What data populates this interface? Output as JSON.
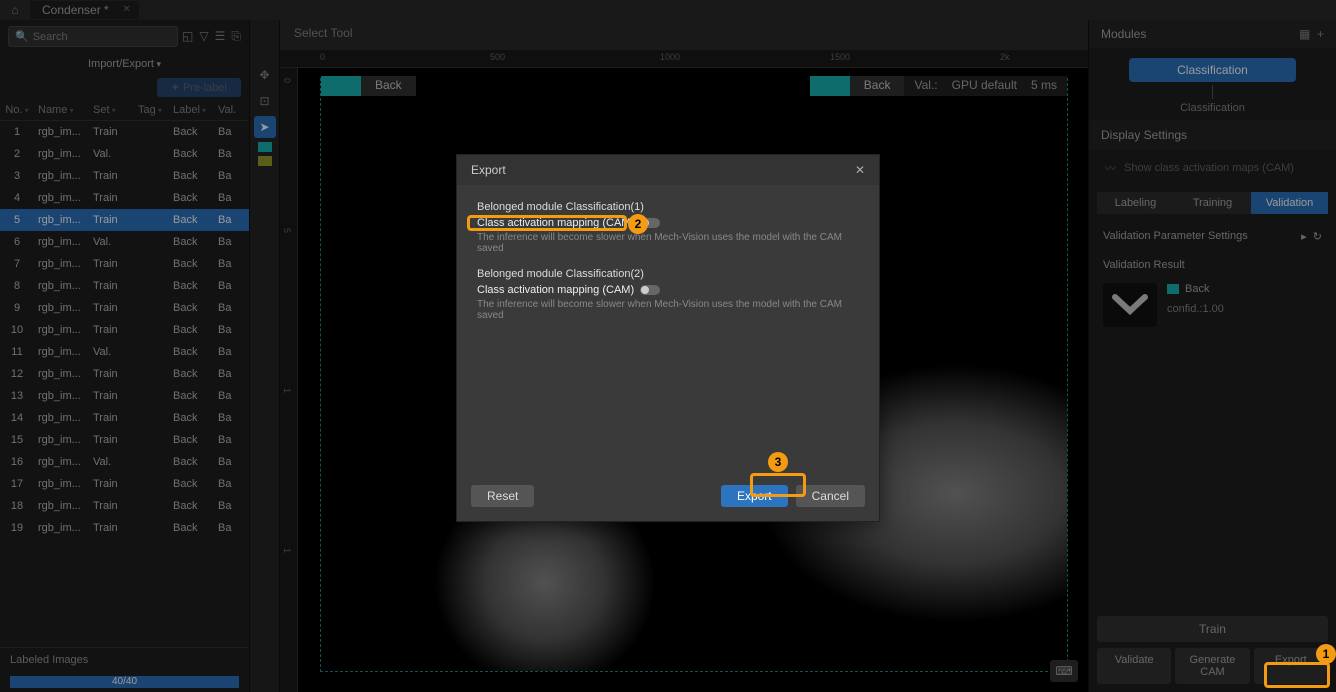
{
  "tab": {
    "title": "Condenser *"
  },
  "search": {
    "placeholder": "Search"
  },
  "left": {
    "import_export": "Import/Export",
    "prelabel": "Pre-label",
    "columns": {
      "no": "No.",
      "name": "Name",
      "set": "Set",
      "tag": "Tag",
      "label": "Label",
      "val": "Val."
    },
    "rows": [
      {
        "no": "1",
        "name": "rgb_im...",
        "set": "Train",
        "label": "Back",
        "val": "Ba"
      },
      {
        "no": "2",
        "name": "rgb_im...",
        "set": "Val.",
        "label": "Back",
        "val": "Ba"
      },
      {
        "no": "3",
        "name": "rgb_im...",
        "set": "Train",
        "label": "Back",
        "val": "Ba"
      },
      {
        "no": "4",
        "name": "rgb_im...",
        "set": "Train",
        "label": "Back",
        "val": "Ba"
      },
      {
        "no": "5",
        "name": "rgb_im...",
        "set": "Train",
        "label": "Back",
        "val": "Ba"
      },
      {
        "no": "6",
        "name": "rgb_im...",
        "set": "Val.",
        "label": "Back",
        "val": "Ba"
      },
      {
        "no": "7",
        "name": "rgb_im...",
        "set": "Train",
        "label": "Back",
        "val": "Ba"
      },
      {
        "no": "8",
        "name": "rgb_im...",
        "set": "Train",
        "label": "Back",
        "val": "Ba"
      },
      {
        "no": "9",
        "name": "rgb_im...",
        "set": "Train",
        "label": "Back",
        "val": "Ba"
      },
      {
        "no": "10",
        "name": "rgb_im...",
        "set": "Train",
        "label": "Back",
        "val": "Ba"
      },
      {
        "no": "11",
        "name": "rgb_im...",
        "set": "Val.",
        "label": "Back",
        "val": "Ba"
      },
      {
        "no": "12",
        "name": "rgb_im...",
        "set": "Train",
        "label": "Back",
        "val": "Ba"
      },
      {
        "no": "13",
        "name": "rgb_im...",
        "set": "Train",
        "label": "Back",
        "val": "Ba"
      },
      {
        "no": "14",
        "name": "rgb_im...",
        "set": "Train",
        "label": "Back",
        "val": "Ba"
      },
      {
        "no": "15",
        "name": "rgb_im...",
        "set": "Train",
        "label": "Back",
        "val": "Ba"
      },
      {
        "no": "16",
        "name": "rgb_im...",
        "set": "Val.",
        "label": "Back",
        "val": "Ba"
      },
      {
        "no": "17",
        "name": "rgb_im...",
        "set": "Train",
        "label": "Back",
        "val": "Ba"
      },
      {
        "no": "18",
        "name": "rgb_im...",
        "set": "Train",
        "label": "Back",
        "val": "Ba"
      },
      {
        "no": "19",
        "name": "rgb_im...",
        "set": "Train",
        "label": "Back",
        "val": "Ba"
      }
    ],
    "labeled_images": "Labeled Images",
    "progress": "40/40"
  },
  "center": {
    "select_tool": "Select Tool",
    "ruler": [
      "0",
      "500",
      "1000",
      "1500",
      "2k"
    ],
    "back1": "Back",
    "back2": "Back",
    "val_label": "Val.:",
    "gpu": "GPU default",
    "timing": "5 ms"
  },
  "right": {
    "modules": "Modules",
    "classification_pill": "Classification",
    "flow_node": "Classification",
    "display_settings": "Display Settings",
    "show_cam": "Show class activation maps (CAM)",
    "tabs": {
      "labeling": "Labeling",
      "training": "Training",
      "validation": "Validation"
    },
    "param": "Validation Parameter Settings",
    "vresult": "Validation Result",
    "res_label": "Back",
    "res_confid": "confid.:1.00",
    "train": "Train",
    "validate": "Validate",
    "gen_cam": "Generate CAM",
    "export": "Export"
  },
  "dialog": {
    "title": "Export",
    "mod1": "Belonged module Classification(1)",
    "cam": "Class activation mapping (CAM)",
    "hint": "The inference will become slower when Mech-Vision uses the model with the CAM saved",
    "mod2": "Belonged module Classification(2)",
    "reset": "Reset",
    "export": "Export",
    "cancel": "Cancel"
  },
  "annotations": {
    "n1": "1",
    "n2": "2",
    "n3": "3"
  }
}
